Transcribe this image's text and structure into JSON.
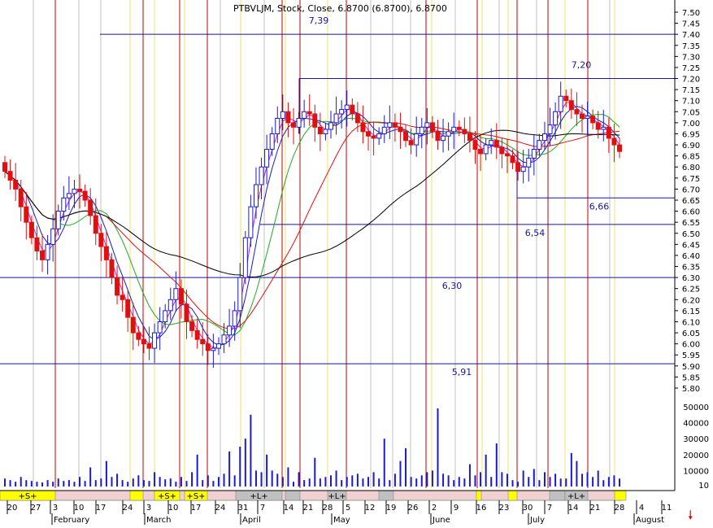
{
  "header": {
    "title_text": "PTBVLJM, Stock, Close, 6.8700 (6.8700), 6.8700"
  },
  "chart_data": {
    "type": "candlestick",
    "symbol": "PTBVLJM",
    "price_axis": {
      "min": 5.75,
      "max": 7.52,
      "step": 0.05,
      "ticks": [
        "7.50",
        "7.45",
        "7.40",
        "7.35",
        "7.30",
        "7.25",
        "7.20",
        "7.15",
        "7.10",
        "7.05",
        "7.00",
        "6.95",
        "6.90",
        "6.85",
        "6.80",
        "6.75",
        "6.70",
        "6.65",
        "6.60",
        "6.55",
        "6.50",
        "6.45",
        "6.40",
        "6.35",
        "6.30",
        "6.25",
        "6.20",
        "6.15",
        "6.10",
        "6.05",
        "6.00",
        "5.95",
        "5.90",
        "5.85",
        "5.80"
      ]
    },
    "volume_axis": {
      "min": 0,
      "max": 55000,
      "ticks": [
        "50000",
        "40000",
        "30000",
        "20000",
        "10000",
        "10"
      ]
    },
    "x_axis": {
      "day_ticks": [
        "20",
        "27",
        "3",
        "10",
        "17",
        "24",
        "3",
        "10",
        "17",
        "24",
        "31",
        "7",
        "14",
        "21",
        "28",
        "5",
        "12",
        "19",
        "26",
        "2",
        "9",
        "16",
        "23",
        "30",
        "7",
        "14",
        "21",
        "28",
        "4",
        "11"
      ],
      "month_labels": [
        "February",
        "March",
        "April",
        "May",
        "June",
        "July",
        "August"
      ]
    },
    "horizontal_levels": [
      {
        "value": 7.4,
        "label": "7,39"
      },
      {
        "value": 7.2,
        "label": "7,20"
      },
      {
        "value": 6.66,
        "label": "6,66"
      },
      {
        "value": 6.54,
        "label": "6,54"
      },
      {
        "value": 6.3,
        "label": "6,30"
      },
      {
        "value": 5.91,
        "label": "5,91"
      }
    ],
    "signal_bar": {
      "labels": [
        "+S+",
        "+S+",
        "+S+",
        "+L+",
        "+L+",
        "+L+"
      ]
    },
    "closes": [
      6.78,
      6.74,
      6.7,
      6.62,
      6.55,
      6.48,
      6.42,
      6.38,
      6.45,
      6.52,
      6.6,
      6.66,
      6.68,
      6.7,
      6.69,
      6.65,
      6.58,
      6.5,
      6.44,
      6.38,
      6.3,
      6.22,
      6.2,
      6.12,
      6.05,
      6.02,
      6.0,
      5.98,
      6.05,
      6.1,
      6.15,
      6.2,
      6.25,
      6.18,
      6.1,
      6.06,
      6.02,
      6.0,
      5.97,
      5.98,
      6.0,
      6.04,
      6.08,
      6.15,
      6.3,
      6.48,
      6.62,
      6.72,
      6.8,
      6.88,
      6.95,
      7.02,
      7.05,
      7.0,
      6.98,
      7.02,
      7.05,
      7.04,
      6.98,
      6.95,
      6.97,
      7.0,
      7.04,
      7.06,
      7.08,
      7.04,
      7.0,
      6.96,
      6.94,
      6.93,
      6.95,
      6.98,
      7.0,
      6.98,
      6.96,
      6.92,
      6.9,
      6.95,
      6.98,
      7.0,
      6.96,
      6.92,
      6.94,
      6.96,
      6.98,
      6.97,
      6.95,
      6.92,
      6.88,
      6.86,
      6.9,
      6.92,
      6.89,
      6.86,
      6.85,
      6.82,
      6.78,
      6.8,
      6.84,
      6.88,
      6.92,
      6.95,
      6.99,
      7.05,
      7.12,
      7.1,
      7.06,
      7.04,
      7.02,
      7.03,
      7.0,
      6.97,
      6.98,
      6.93,
      6.9,
      6.87
    ],
    "volumes": [
      5000,
      4000,
      3000,
      6000,
      4000,
      3500,
      3000,
      2500,
      4000,
      3000,
      5000,
      3500,
      4000,
      3000,
      6000,
      3500,
      12000,
      4000,
      5000,
      16000,
      6000,
      8000,
      4000,
      3000,
      5000,
      7000,
      4000,
      3500,
      9000,
      6000,
      4500,
      5000,
      3000,
      6000,
      3500,
      9000,
      20000,
      4000,
      7000,
      3500,
      6000,
      8000,
      22000,
      7000,
      25000,
      30000,
      45000,
      10000,
      9000,
      20000,
      10000,
      8000,
      6000,
      12000,
      3000,
      9000,
      4000,
      5000,
      18000,
      5000,
      6000,
      7000,
      10000,
      4000,
      6000,
      7000,
      8000,
      5000,
      6000,
      9000,
      5000,
      30000,
      4000,
      8000,
      16000,
      24000,
      6000,
      5000,
      7000,
      9000,
      10000,
      49000,
      8000,
      7000,
      4000,
      6000,
      5000,
      14000,
      7000,
      9000,
      20000,
      6000,
      27000,
      9000,
      8000,
      4000,
      3000,
      10000,
      6000,
      11000,
      4000,
      9000,
      6000,
      8000,
      5000,
      5000,
      21000,
      16000,
      8000,
      9000,
      6000,
      10000,
      4000,
      6000,
      7000,
      5000
    ]
  }
}
